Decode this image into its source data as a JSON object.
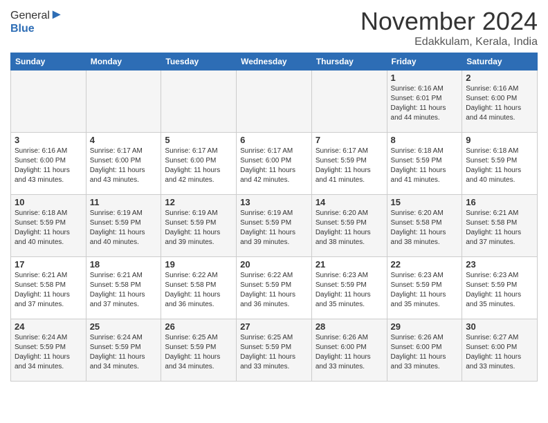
{
  "header": {
    "logo_general": "General",
    "logo_blue": "Blue",
    "month_year": "November 2024",
    "location": "Edakkulam, Kerala, India"
  },
  "weekdays": [
    "Sunday",
    "Monday",
    "Tuesday",
    "Wednesday",
    "Thursday",
    "Friday",
    "Saturday"
  ],
  "weeks": [
    [
      {
        "day": "",
        "info": ""
      },
      {
        "day": "",
        "info": ""
      },
      {
        "day": "",
        "info": ""
      },
      {
        "day": "",
        "info": ""
      },
      {
        "day": "",
        "info": ""
      },
      {
        "day": "1",
        "info": "Sunrise: 6:16 AM\nSunset: 6:01 PM\nDaylight: 11 hours\nand 44 minutes."
      },
      {
        "day": "2",
        "info": "Sunrise: 6:16 AM\nSunset: 6:00 PM\nDaylight: 11 hours\nand 44 minutes."
      }
    ],
    [
      {
        "day": "3",
        "info": "Sunrise: 6:16 AM\nSunset: 6:00 PM\nDaylight: 11 hours\nand 43 minutes."
      },
      {
        "day": "4",
        "info": "Sunrise: 6:17 AM\nSunset: 6:00 PM\nDaylight: 11 hours\nand 43 minutes."
      },
      {
        "day": "5",
        "info": "Sunrise: 6:17 AM\nSunset: 6:00 PM\nDaylight: 11 hours\nand 42 minutes."
      },
      {
        "day": "6",
        "info": "Sunrise: 6:17 AM\nSunset: 6:00 PM\nDaylight: 11 hours\nand 42 minutes."
      },
      {
        "day": "7",
        "info": "Sunrise: 6:17 AM\nSunset: 5:59 PM\nDaylight: 11 hours\nand 41 minutes."
      },
      {
        "day": "8",
        "info": "Sunrise: 6:18 AM\nSunset: 5:59 PM\nDaylight: 11 hours\nand 41 minutes."
      },
      {
        "day": "9",
        "info": "Sunrise: 6:18 AM\nSunset: 5:59 PM\nDaylight: 11 hours\nand 40 minutes."
      }
    ],
    [
      {
        "day": "10",
        "info": "Sunrise: 6:18 AM\nSunset: 5:59 PM\nDaylight: 11 hours\nand 40 minutes."
      },
      {
        "day": "11",
        "info": "Sunrise: 6:19 AM\nSunset: 5:59 PM\nDaylight: 11 hours\nand 40 minutes."
      },
      {
        "day": "12",
        "info": "Sunrise: 6:19 AM\nSunset: 5:59 PM\nDaylight: 11 hours\nand 39 minutes."
      },
      {
        "day": "13",
        "info": "Sunrise: 6:19 AM\nSunset: 5:59 PM\nDaylight: 11 hours\nand 39 minutes."
      },
      {
        "day": "14",
        "info": "Sunrise: 6:20 AM\nSunset: 5:59 PM\nDaylight: 11 hours\nand 38 minutes."
      },
      {
        "day": "15",
        "info": "Sunrise: 6:20 AM\nSunset: 5:58 PM\nDaylight: 11 hours\nand 38 minutes."
      },
      {
        "day": "16",
        "info": "Sunrise: 6:21 AM\nSunset: 5:58 PM\nDaylight: 11 hours\nand 37 minutes."
      }
    ],
    [
      {
        "day": "17",
        "info": "Sunrise: 6:21 AM\nSunset: 5:58 PM\nDaylight: 11 hours\nand 37 minutes."
      },
      {
        "day": "18",
        "info": "Sunrise: 6:21 AM\nSunset: 5:58 PM\nDaylight: 11 hours\nand 37 minutes."
      },
      {
        "day": "19",
        "info": "Sunrise: 6:22 AM\nSunset: 5:58 PM\nDaylight: 11 hours\nand 36 minutes."
      },
      {
        "day": "20",
        "info": "Sunrise: 6:22 AM\nSunset: 5:59 PM\nDaylight: 11 hours\nand 36 minutes."
      },
      {
        "day": "21",
        "info": "Sunrise: 6:23 AM\nSunset: 5:59 PM\nDaylight: 11 hours\nand 35 minutes."
      },
      {
        "day": "22",
        "info": "Sunrise: 6:23 AM\nSunset: 5:59 PM\nDaylight: 11 hours\nand 35 minutes."
      },
      {
        "day": "23",
        "info": "Sunrise: 6:23 AM\nSunset: 5:59 PM\nDaylight: 11 hours\nand 35 minutes."
      }
    ],
    [
      {
        "day": "24",
        "info": "Sunrise: 6:24 AM\nSunset: 5:59 PM\nDaylight: 11 hours\nand 34 minutes."
      },
      {
        "day": "25",
        "info": "Sunrise: 6:24 AM\nSunset: 5:59 PM\nDaylight: 11 hours\nand 34 minutes."
      },
      {
        "day": "26",
        "info": "Sunrise: 6:25 AM\nSunset: 5:59 PM\nDaylight: 11 hours\nand 34 minutes."
      },
      {
        "day": "27",
        "info": "Sunrise: 6:25 AM\nSunset: 5:59 PM\nDaylight: 11 hours\nand 33 minutes."
      },
      {
        "day": "28",
        "info": "Sunrise: 6:26 AM\nSunset: 6:00 PM\nDaylight: 11 hours\nand 33 minutes."
      },
      {
        "day": "29",
        "info": "Sunrise: 6:26 AM\nSunset: 6:00 PM\nDaylight: 11 hours\nand 33 minutes."
      },
      {
        "day": "30",
        "info": "Sunrise: 6:27 AM\nSunset: 6:00 PM\nDaylight: 11 hours\nand 33 minutes."
      }
    ]
  ]
}
